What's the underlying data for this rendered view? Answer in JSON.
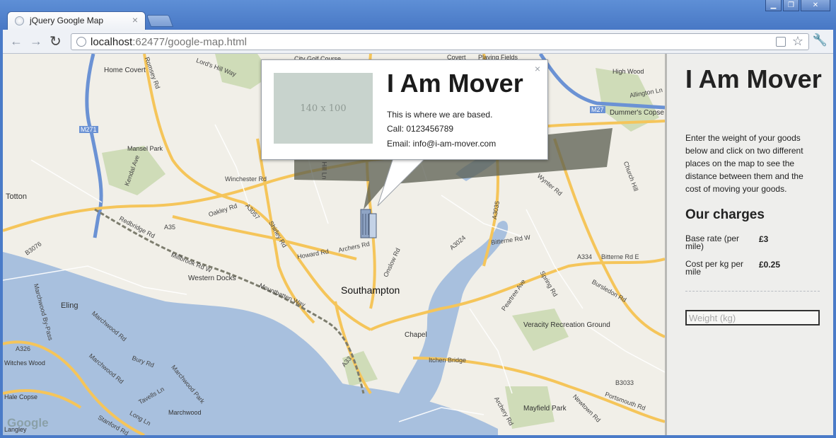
{
  "browser": {
    "tab_title": "jQuery Google Map",
    "tab_close": "×",
    "url_host": "localhost",
    "url_rest": ":62477/google-map.html",
    "back": "←",
    "forward": "→",
    "reload": "↻",
    "star": "☆",
    "wrench": "🔧",
    "window_buttons": [
      "▁",
      "❐",
      "✕"
    ]
  },
  "map": {
    "labels": [
      "City Golf Course",
      "Covert",
      "Playing Fields",
      "Home Covert",
      "Lord's Hill Way",
      "Romsey Rd",
      "High Wood",
      "Dummer's Copse",
      "Allington Ln",
      "M27",
      "M271",
      "Mansel Park",
      "Kendal Ave",
      "Winchester Rd",
      "Hill Ln",
      "Totton",
      "A35",
      "Redbridge Rd",
      "Oakley Rd",
      "A3057",
      "Shirley Rd",
      "Archers Rd",
      "Howard Rd",
      "Onslow Rd",
      "A3024",
      "Bitterne Rd W",
      "A3035",
      "A334",
      "Bitterne Rd E",
      "Wynter Rd",
      "Church Hill",
      "Millbrook Rd W",
      "Western Docks",
      "Mountbatten Way",
      "Southampton",
      "Eling",
      "B3076",
      "Marchwood By-Pass",
      "A326",
      "A33",
      "Chapel",
      "Itchen Bridge",
      "Veracity Recreation Ground",
      "Peartree Ave",
      "Spring Rd",
      "Bursledon Rd",
      "Marchwood Rd",
      "Bury Rd",
      "Marchwood",
      "Mayfield Park",
      "Portsmouth Rd",
      "B3033",
      "Newtown Rd",
      "Archery Rd",
      "Tavells Ln",
      "Long Ln",
      "Marchwood Park",
      "Marchwood Rd",
      "Google",
      "Stanford Rd",
      "Witches Wood",
      "Hale Copse",
      "Langley"
    ],
    "brand": "Google"
  },
  "infowindow": {
    "image_placeholder": "140 x 100",
    "title": "I Am Mover",
    "line1": "This is where we are based.",
    "line2": "Call: 0123456789",
    "line3": "Email: info@i-am-mover.com",
    "close": "×"
  },
  "panel": {
    "title": "I Am Mover",
    "description": "Enter the weight of your goods below and click on two different places on the map to see the distance between them and the cost of moving your goods.",
    "charges_heading": "Our charges",
    "base_rate_label": "Base rate (per mile)",
    "base_rate_value": "£3",
    "cost_per_kg_label": "Cost per kg per mile",
    "cost_per_kg_value": "£0.25",
    "weight_placeholder": "Weight (kg)",
    "weight_value": ""
  }
}
